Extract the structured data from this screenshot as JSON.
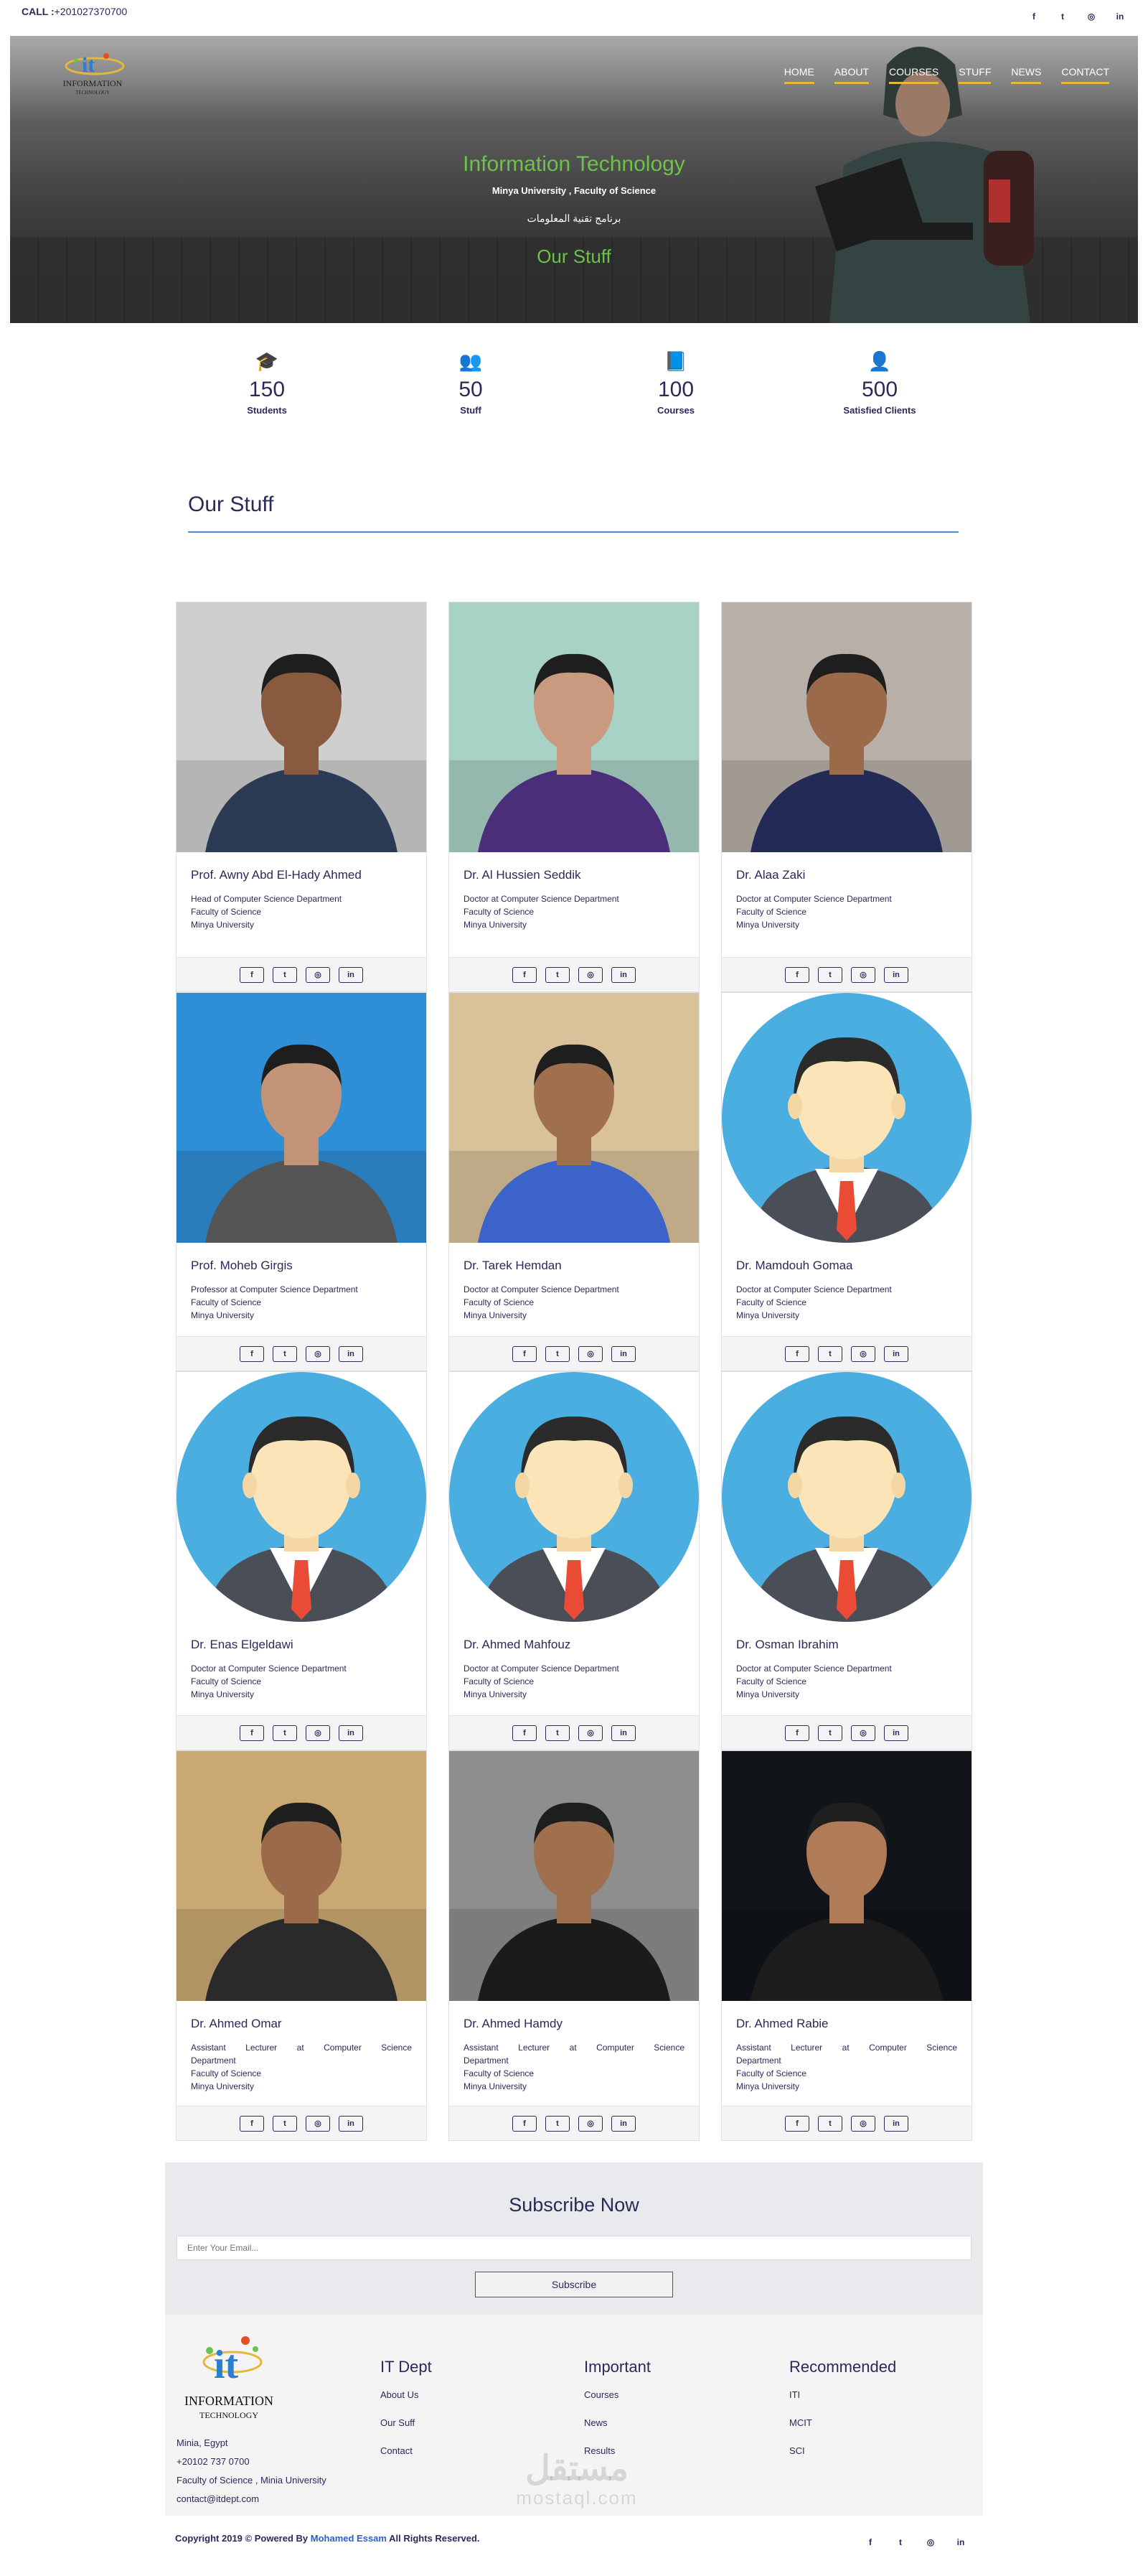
{
  "topbar": {
    "call_label": "CALL :",
    "phone": "+201027370700",
    "social": [
      "f",
      "t",
      "◎",
      "in"
    ]
  },
  "hero": {
    "logo_line1": "INFORMATION",
    "logo_line2": "TECHNOLOGY",
    "nav": [
      "HOME",
      "ABOUT",
      "COURSES",
      "STUFF",
      "NEWS",
      "CONTACT"
    ],
    "title": "Information Technology",
    "subtitle": "Minya University , Faculty of Science",
    "arabic": "برنامج تقنية المعلومات",
    "page_heading": "Our Stuff"
  },
  "stats": [
    {
      "icon": "graduation-cap-icon",
      "glyph": "🎓",
      "value": "150",
      "label": "Students"
    },
    {
      "icon": "users-icon",
      "glyph": "👥",
      "value": "50",
      "label": "Stuff"
    },
    {
      "icon": "book-icon",
      "glyph": "📘",
      "value": "100",
      "label": "Courses"
    },
    {
      "icon": "user-circle-icon",
      "glyph": "👤",
      "value": "500",
      "label": "Satisfied Clients"
    }
  ],
  "section": {
    "title": "Our Stuff"
  },
  "staff": [
    {
      "name": "Prof. Awny Abd El-Hady Ahmed",
      "lines": [
        "Head of Computer Science Department",
        "Faculty of Science",
        "Minya University"
      ]
    },
    {
      "name": "Dr. Al Hussien Seddik",
      "lines": [
        "Doctor at Computer Science Department",
        "Faculty of Science",
        "Minya University"
      ]
    },
    {
      "name": "Dr. Alaa Zaki",
      "lines": [
        "Doctor at Computer Science Department",
        "Faculty of Science",
        "Minya University"
      ]
    },
    {
      "name": "Prof. Moheb Girgis",
      "lines": [
        "Professor at Computer Science Department",
        "Faculty of Science",
        "Minya University"
      ]
    },
    {
      "name": "Dr. Tarek Hemdan",
      "lines": [
        "Doctor at Computer Science Department",
        "Faculty of Science",
        "Minya University"
      ]
    },
    {
      "name": "Dr. Mamdouh Gomaa",
      "lines": [
        "Doctor at Computer Science Department",
        "Faculty of Science",
        "Minya University"
      ]
    },
    {
      "name": "Dr. Enas Elgeldawi",
      "lines": [
        "Doctor at Computer Science Department",
        "Faculty of Science",
        "Minya University"
      ]
    },
    {
      "name": "Dr. Ahmed Mahfouz",
      "lines": [
        "Doctor at Computer Science Department",
        "Faculty of Science",
        "Minya University"
      ]
    },
    {
      "name": "Dr. Osman Ibrahim",
      "lines": [
        "Doctor at Computer Science Department",
        "Faculty of Science",
        "Minya University"
      ]
    },
    {
      "name": "Dr. Ahmed Omar",
      "lines": [
        "Assistant Lecturer at Computer Science",
        "Department",
        "Faculty of Science",
        "Minya University"
      ]
    },
    {
      "name": "Dr. Ahmed Hamdy",
      "lines": [
        "Assistant Lecturer at Computer Science",
        "Department",
        "Faculty of Science",
        "Minya University"
      ]
    },
    {
      "name": "Dr. Ahmed Rabie",
      "lines": [
        "Assistant Lecturer at Computer Science",
        "Department",
        "Faculty of Science",
        "Minya University"
      ]
    }
  ],
  "card_social": [
    "f",
    "t",
    "◎",
    "in"
  ],
  "subscribe": {
    "title": "Subscribe Now",
    "placeholder": "Enter Your Email...",
    "button": "Subscribe"
  },
  "footer": {
    "logo_line1": "INFORMATION",
    "logo_line2": "TECHNOLOGY",
    "contact": [
      "Minia, Egypt",
      "+20102 737 0700",
      "Faculty of Science , Minia University",
      "contact@itdept.com"
    ],
    "columns": [
      {
        "title": "IT Dept",
        "links": [
          "About Us",
          "Our Suff",
          "Contact"
        ]
      },
      {
        "title": "Important",
        "links": [
          "Courses",
          "News",
          "Results"
        ]
      },
      {
        "title": "Recommended",
        "links": [
          "ITI",
          "MCIT",
          "SCI"
        ]
      }
    ],
    "watermark_ar": "مستقل",
    "watermark_en": "mostaql.com",
    "copyright_prefix": "Copyright 2019 © Powered By",
    "copyright_author": "Mohamed Essam",
    "copyright_suffix": "All Rights Reserved.",
    "social": [
      "f",
      "t",
      "◎",
      "in"
    ]
  }
}
